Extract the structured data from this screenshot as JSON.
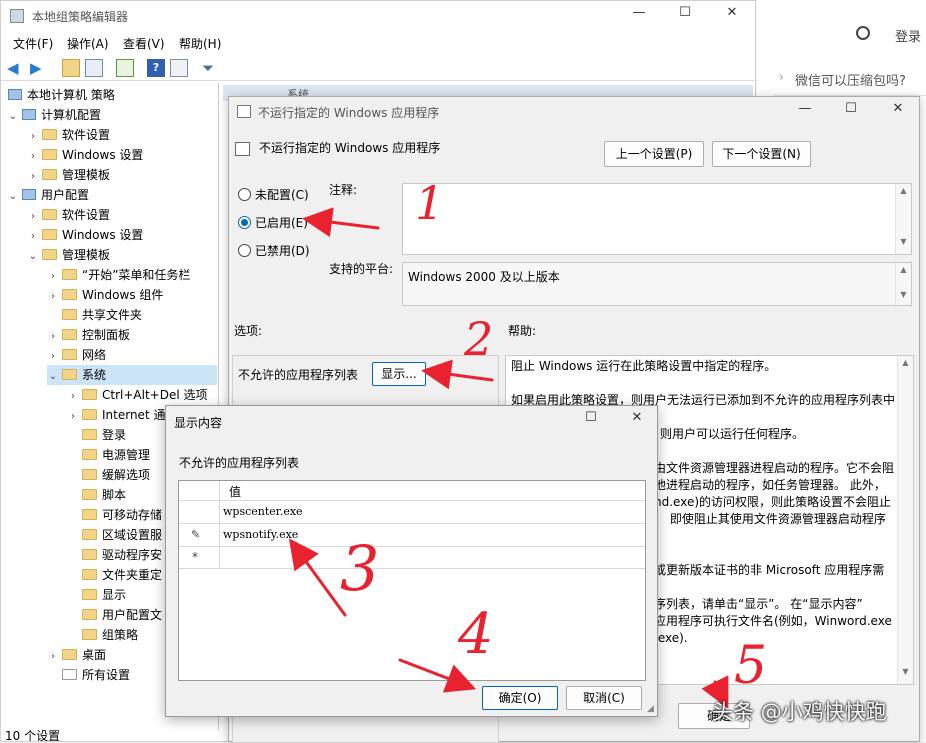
{
  "editor": {
    "title": "本地组策略编辑器",
    "menu": [
      "文件(F)",
      "操作(A)",
      "查看(V)",
      "帮助(H)"
    ],
    "status": "10 个设置"
  },
  "tree": {
    "root": "本地计算机 策略",
    "computer_config": "计算机配置",
    "user_config": "用户配置",
    "software_settings": "软件设置",
    "windows_settings": "Windows 设置",
    "admin_templates": "管理模板",
    "admin_children": [
      "“开始”菜单和任务栏",
      "Windows 组件",
      "共享文件夹",
      "控制面板",
      "网络"
    ],
    "system": "系统",
    "system_children": [
      "Ctrl+Alt+Del 选项",
      "Internet 通",
      "登录",
      "电源管理",
      "缓解选项",
      "脚本",
      "可移动存储",
      "区域设置服",
      "驱动程序安",
      "文件夹重定",
      "显示",
      "用户配置文",
      "组策略"
    ],
    "desktop": "桌面",
    "all_settings": "所有设置"
  },
  "browser": {
    "login": "登录",
    "snippet": "微信可以压缩包吗?",
    "tab_fragment": "系统"
  },
  "policy_dialog": {
    "window_title": "不运行指定的 Windows 应用程序",
    "heading": "不运行指定的 Windows 应用程序",
    "prev_button": "上一个设置(P)",
    "next_button": "下一个设置(N)",
    "radio_not_configured": "未配置(C)",
    "radio_enabled": "已启用(E)",
    "radio_disabled": "已禁用(D)",
    "comment_label": "注释:",
    "platform_label": "支持的平台:",
    "platform_value": "Windows 2000 及以上版本",
    "options_label": "选项:",
    "help_label": "帮助:",
    "option_list_label": "不允许的应用程序列表",
    "show_button": "显示...",
    "help_lines": [
      "阻止 Windows 运行在此策略设置中指定的程序。",
      "",
      "如果启用此策略设置，则用户无法运行已添加到不允许的应用程序列表中",
      "",
      "置，则用户可以运行任何程序。",
      "",
      "由文件资源管理器进程启动的程序。它不会阻",
      "他进程启动的程序，如任务管理器。 此外，",
      "nd.exe)的访问权限，则此策略设置不会阻止",
      "。 即使阻止其使用文件资源管理器启动程序",
      "",
      "",
      "或更新版本证书的非 Microsoft 应用程序需",
      "",
      "序列表，请单击“显示”。 在“显示内容”",
      "应用程序可执行文件名(例如，Winword.exe",
      ".exe)."
    ],
    "ok_button_fragment": "确定"
  },
  "show_dialog": {
    "title": "显示内容",
    "list_label": "不允许的应用程序列表",
    "column_header": "值",
    "rows": [
      "wpscenter.exe",
      "wpsnotify.exe",
      ""
    ],
    "ok_button": "确定(O)",
    "cancel_button": "取消(C)"
  },
  "annotations": {
    "numbers": [
      "1",
      "2",
      "3",
      "4",
      "5"
    ],
    "color": "#e8222e"
  },
  "watermark": "头条 @小鸡快快跑",
  "colors": {
    "accent": "#0067c0",
    "selection": "#cce4f7",
    "folder": "#f1d487"
  }
}
